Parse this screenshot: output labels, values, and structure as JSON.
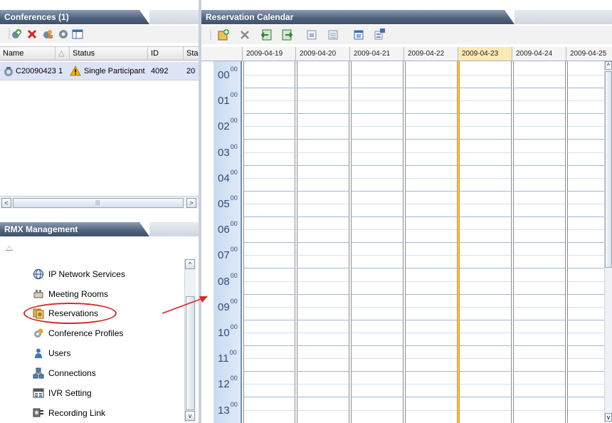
{
  "conferences_panel": {
    "title": "Conferences (1)",
    "columns": [
      "Name",
      "Status",
      "ID",
      "Sta"
    ],
    "rows": [
      {
        "name": "C20090423 1",
        "status": "Single Participant",
        "id": "4092",
        "sta": "20"
      }
    ]
  },
  "toolbar_left": {
    "icons": [
      "new-conference-icon",
      "delete-icon",
      "conference-participant-icon",
      "conference-settings-icon",
      "view-icon"
    ]
  },
  "management": {
    "title": "RMX Management",
    "items": [
      {
        "label": "IP Network Services",
        "icon": "globe-icon"
      },
      {
        "label": "Meeting Rooms",
        "icon": "meeting-room-icon"
      },
      {
        "label": "Reservations",
        "icon": "reservations-icon"
      },
      {
        "label": "Conference Profiles",
        "icon": "conference-profile-icon"
      },
      {
        "label": "Users",
        "icon": "user-icon"
      },
      {
        "label": "Connections",
        "icon": "connections-icon"
      },
      {
        "label": "IVR Setting",
        "icon": "ivr-icon"
      },
      {
        "label": "Recording Link",
        "icon": "recording-link-icon"
      }
    ]
  },
  "calendar": {
    "title": "Reservation Calendar",
    "toolbar_icons": [
      "new-reservation-icon",
      "delete-icon",
      "previous-icon",
      "next-icon",
      "day-view-icon",
      "week-view-icon",
      "month-view-icon",
      "today-icon"
    ],
    "dates": [
      "2009-04-19",
      "2009-04-20",
      "2009-04-21",
      "2009-04-22",
      "2009-04-23",
      "2009-04-24",
      "2009-04-25"
    ],
    "today": "2009-04-23",
    "hours": [
      "00",
      "01",
      "02",
      "03",
      "04",
      "05",
      "06",
      "07",
      "08",
      "09",
      "10",
      "11",
      "12",
      "13"
    ],
    "minutes": "00"
  },
  "colors": {
    "title_bar": "#4f627c",
    "selection": "#dde4f6",
    "today_column": "#f0c15a",
    "hour_column": "#c9dbf1",
    "highlight": "#d92a2a"
  }
}
